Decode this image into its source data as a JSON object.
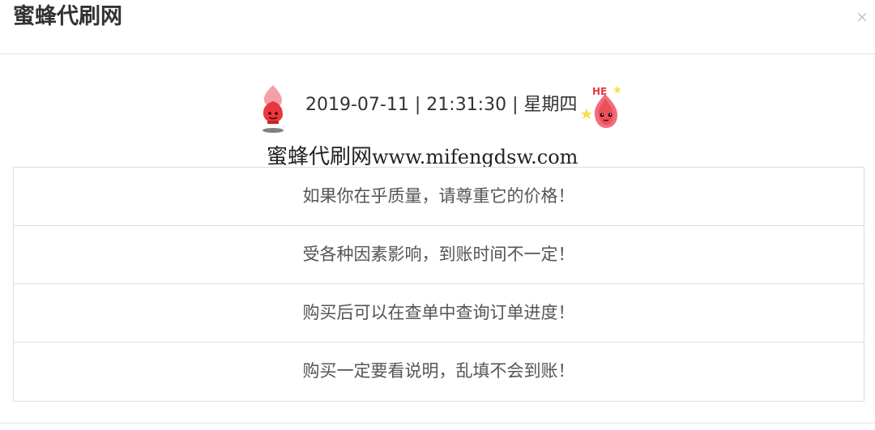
{
  "modal": {
    "title": "蜜蜂代刷网",
    "close_label": "×"
  },
  "clock": {
    "date": "2019-07-11",
    "time": "21:31:30",
    "weekday": "星期四",
    "separator": "|",
    "left_mascot_icon": "red-flame-mascot-icon",
    "right_mascot_icon": "he-flame-mascot-icon",
    "right_mascot_text": "HE"
  },
  "site": {
    "name": "蜜蜂代刷网",
    "url": "www.mifengdsw.com"
  },
  "notices": [
    "如果你在乎质量，请尊重它的价格！",
    "受各种因素影响，到账时间不一定！",
    "购买后可以在查单中查询订单进度！",
    "购买一定要看说明，乱填不会到账！"
  ],
  "colors": {
    "mascot_red": "#e8383d",
    "mascot_pink": "#f26d7d",
    "border": "#dddddd"
  }
}
